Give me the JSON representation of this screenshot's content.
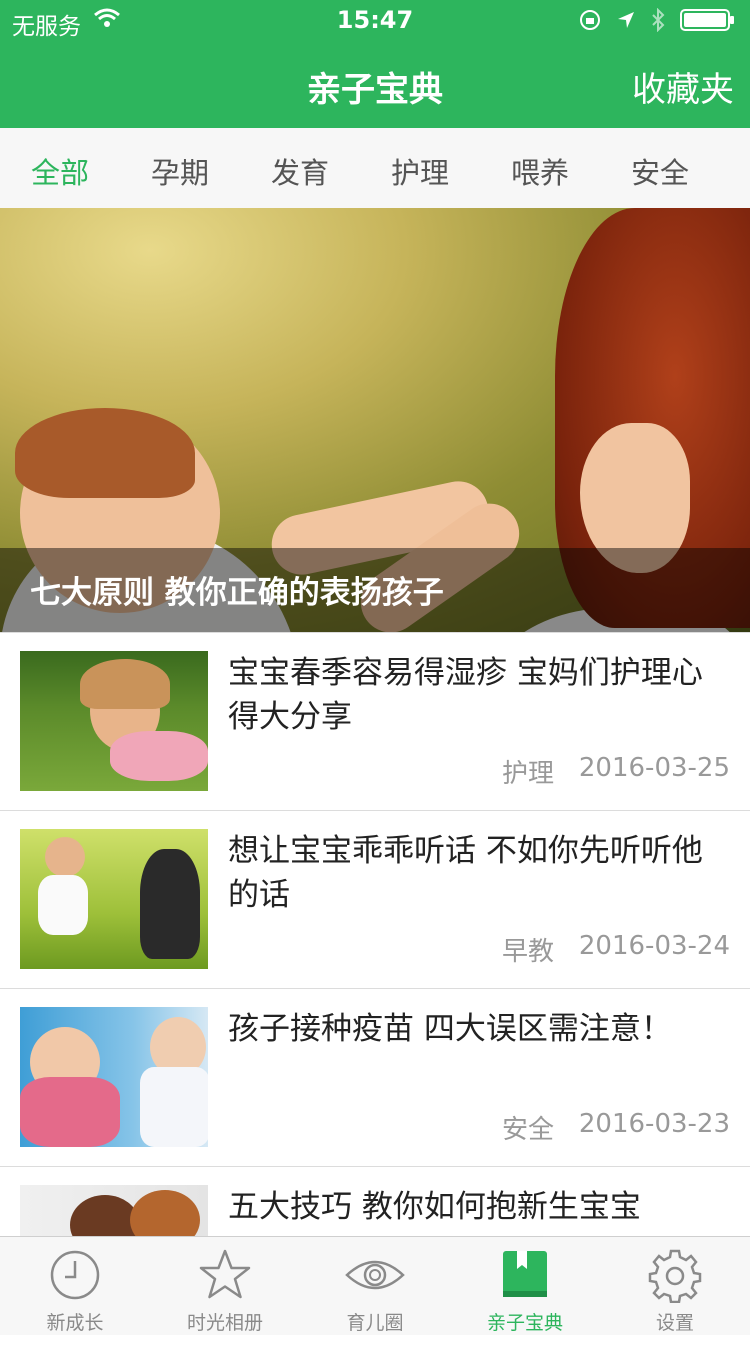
{
  "status_bar": {
    "carrier": "无服务",
    "time": "15:47"
  },
  "nav": {
    "title": "亲子宝典",
    "right_action": "收藏夹"
  },
  "categories": {
    "active_index": 0,
    "items": [
      "全部",
      "孕期",
      "发育",
      "护理",
      "喂养",
      "安全"
    ]
  },
  "hero": {
    "caption": "七大原则 教你正确的表扬孩子"
  },
  "articles": [
    {
      "title": "宝宝春季容易得湿疹 宝妈们护理心得大分享",
      "category": "护理",
      "date": "2016-03-25",
      "thumb_icon": "girl-on-grass-photo"
    },
    {
      "title": "想让宝宝乖乖听话 不如你先听听他的话",
      "category": "早教",
      "date": "2016-03-24",
      "thumb_icon": "mother-and-son-photo"
    },
    {
      "title": "孩子接种疫苗 四大误区需注意！",
      "category": "安全",
      "date": "2016-03-23",
      "thumb_icon": "vaccination-photo"
    },
    {
      "title": "五大技巧 教你如何抱新生宝宝",
      "category": "",
      "date": "",
      "thumb_icon": "parents-photo"
    }
  ],
  "tab_bar": {
    "active_index": 3,
    "items": [
      {
        "label": "新成长",
        "icon": "clock-icon"
      },
      {
        "label": "时光相册",
        "icon": "star-icon"
      },
      {
        "label": "育儿圈",
        "icon": "eye-icon"
      },
      {
        "label": "亲子宝典",
        "icon": "book-icon"
      },
      {
        "label": "设置",
        "icon": "gear-icon"
      }
    ]
  },
  "colors": {
    "brand": "#2db55d",
    "inactive": "#8a8a8a"
  }
}
